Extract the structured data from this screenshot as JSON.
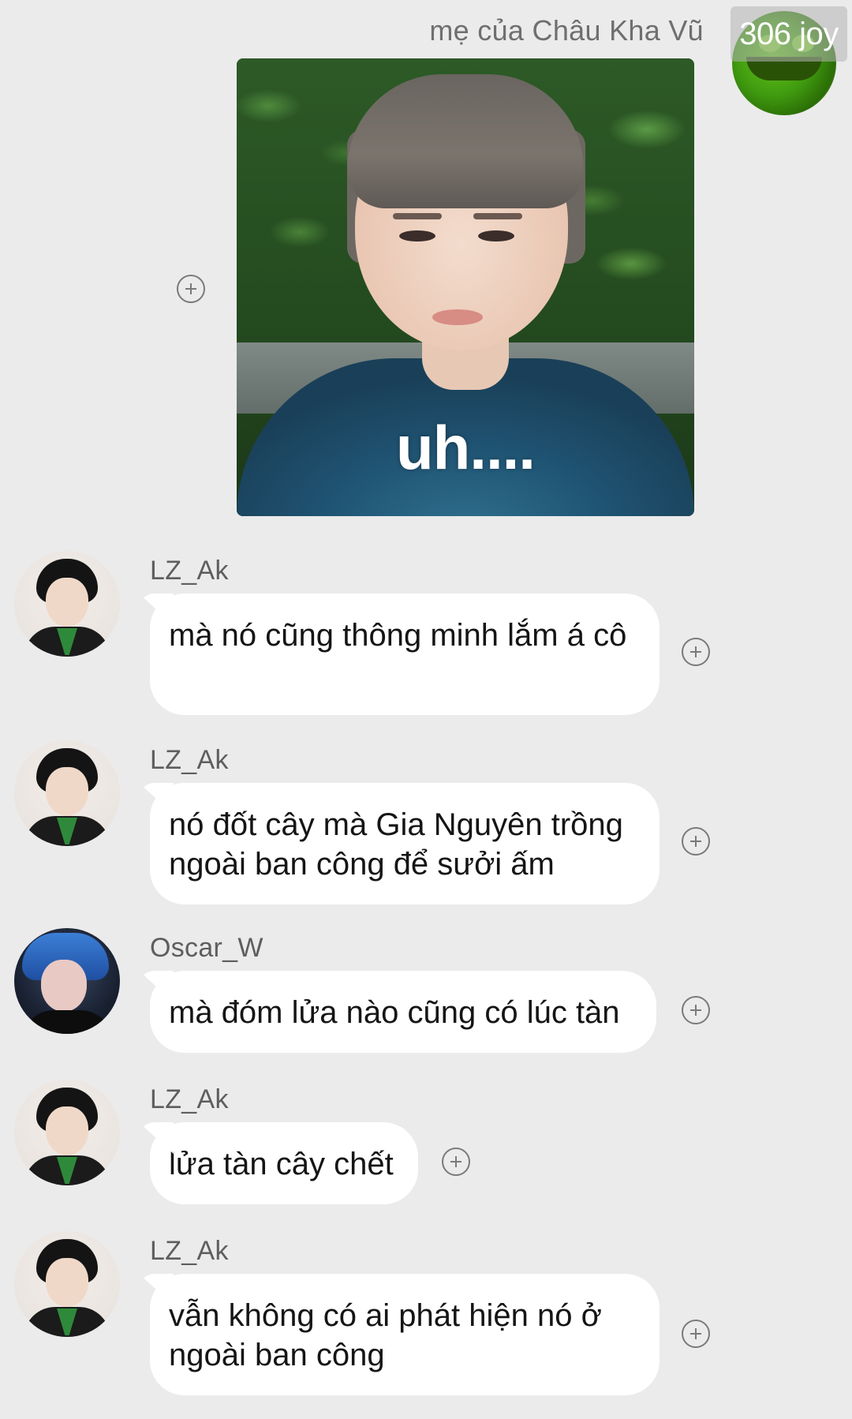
{
  "outgoing": {
    "sender_name": "mẹ của Châu Kha Vũ",
    "badge": "306 joy",
    "image_caption": "uh...."
  },
  "messages": [
    {
      "sender": "LZ_Ak",
      "avatar": "lz-ak-avatar",
      "text": "mà nó cũng thông minh lắm á cô"
    },
    {
      "sender": "LZ_Ak",
      "avatar": "lz-ak-avatar",
      "text": "nó đốt cây mà Gia Nguyên trồng ngoài ban công để sưởi ấm"
    },
    {
      "sender": "Oscar_W",
      "avatar": "oscar-w-avatar",
      "text": "mà đóm lửa nào cũng có lúc tàn"
    },
    {
      "sender": "LZ_Ak",
      "avatar": "lz-ak-avatar",
      "text": "lửa tàn cây chết"
    },
    {
      "sender": "LZ_Ak",
      "avatar": "lz-ak-avatar",
      "text": "vẫn không có ai phát hiện nó ở ngoài ban công"
    }
  ],
  "icons": {
    "add_reaction": "plus-circle-icon"
  },
  "colors": {
    "background": "#ebebeb",
    "bubble": "#ffffff",
    "name_text": "#5e5e5e"
  }
}
